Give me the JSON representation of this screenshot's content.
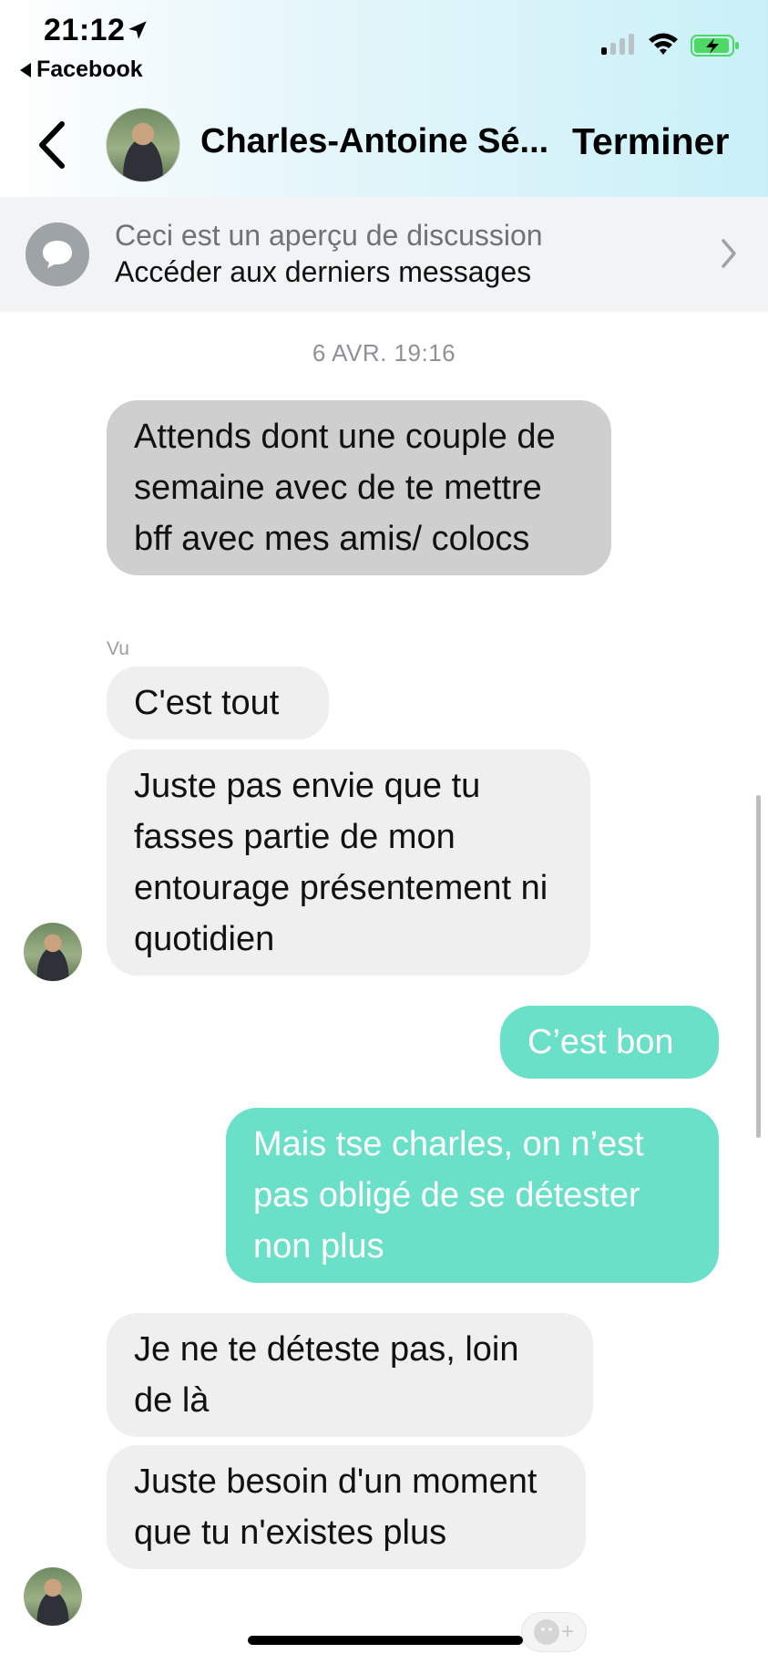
{
  "status_bar": {
    "time": "21:12",
    "back_app": "Facebook",
    "icons": [
      "location-arrow-icon",
      "cellular-signal-icon",
      "wifi-icon",
      "battery-charging-icon"
    ]
  },
  "header": {
    "contact_name": "Charles-Antoine Sé...",
    "done_label": "Terminer",
    "icons": [
      "back-chevron-icon",
      "contact-avatar"
    ]
  },
  "preview_banner": {
    "line1": "Ceci est un aperçu de discussion",
    "line2": "Accéder aux derniers messages",
    "icons": [
      "chat-bubble-icon",
      "chevron-right-icon"
    ]
  },
  "conversation": {
    "timestamp": "6 AVR. 19:16",
    "seen_label": "Vu",
    "messages": [
      {
        "from": "contact",
        "text": "Attends dont une couple de semaine avec de te mettre bff avec mes amis/ colocs"
      },
      {
        "from": "contact",
        "text": "C'est tout"
      },
      {
        "from": "contact",
        "text": "Juste pas envie que tu fasses partie de mon entourage présentement ni quotidien"
      },
      {
        "from": "me",
        "text": "C’est bon"
      },
      {
        "from": "me",
        "text": "Mais tse charles, on n’est pas obligé de se détester non plus"
      },
      {
        "from": "contact",
        "text": "Je ne te déteste pas, loin de là"
      },
      {
        "from": "contact",
        "text": "Juste besoin d'un moment que tu n'existes plus"
      }
    ]
  },
  "reaction": {
    "plus": "+"
  },
  "colors": {
    "outgoing_bubble": "#6be0c9",
    "incoming_bubble": "#efefef",
    "selected_bubble": "#cfcfcf",
    "banner_bg": "#f2f3f5",
    "header_gradient_end": "#c9f0f8"
  }
}
